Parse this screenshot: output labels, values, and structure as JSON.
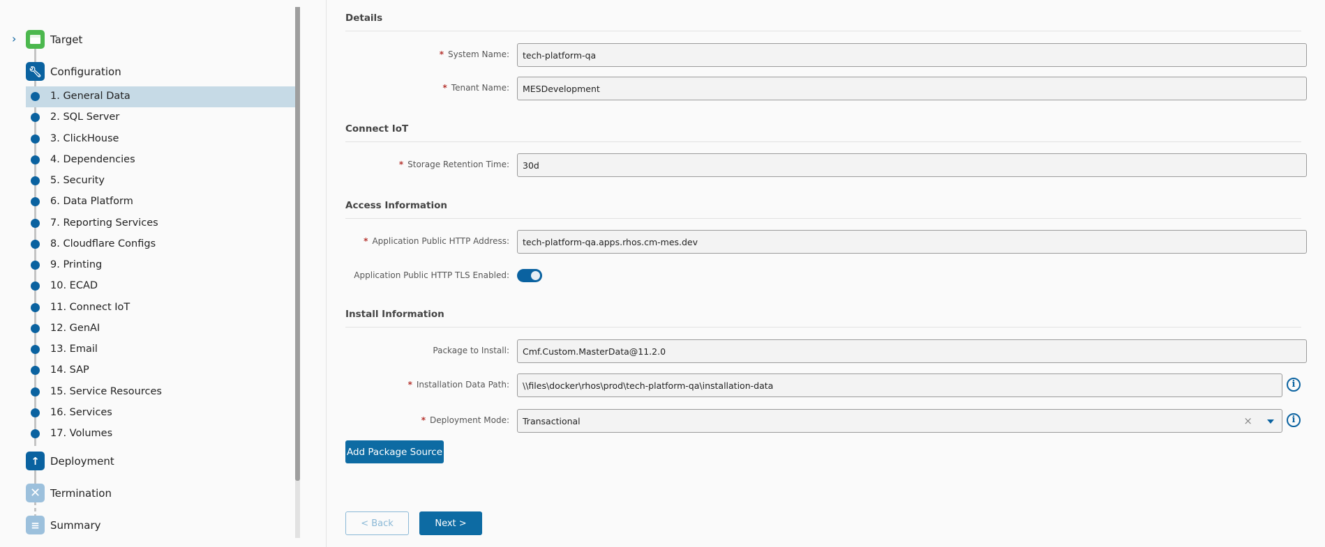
{
  "nav": {
    "phases": {
      "target": "Target",
      "configuration": "Configuration",
      "deployment": "Deployment",
      "termination": "Termination",
      "summary": "Summary"
    },
    "steps": [
      "1. General Data",
      "2. SQL Server",
      "3. ClickHouse",
      "4. Dependencies",
      "5. Security",
      "6. Data Platform",
      "7. Reporting Services",
      "8. Cloudflare Configs",
      "9. Printing",
      "10. ECAD",
      "11. Connect IoT",
      "12. GenAI",
      "13. Email",
      "14. SAP",
      "15. Service Resources",
      "16. Services",
      "17. Volumes"
    ],
    "active_step": 0
  },
  "form": {
    "details": {
      "title": "Details",
      "system_name_label": "System Name:",
      "system_name": "tech-platform-qa",
      "tenant_name_label": "Tenant Name:",
      "tenant_name": "MESDevelopment"
    },
    "connect_iot": {
      "title": "Connect IoT",
      "retention_label": "Storage Retention Time:",
      "retention": "30d"
    },
    "access": {
      "title": "Access Information",
      "address_label": "Application Public HTTP Address:",
      "address": "tech-platform-qa.apps.rhos.cm-mes.dev",
      "tls_label": "Application Public HTTP TLS Enabled:",
      "tls_enabled": true
    },
    "install": {
      "title": "Install Information",
      "package_label": "Package to Install:",
      "package": "Cmf.Custom.MasterData@11.2.0",
      "path_label": "Installation Data Path:",
      "path": "\\\\files\\docker\\rhos\\prod\\tech-platform-qa\\installation-data",
      "mode_label": "Deployment Mode:",
      "mode": "Transactional",
      "add_source": "Add Package Source"
    },
    "required_mark": "*",
    "info_glyph": "i",
    "clear_glyph": "×"
  },
  "footer": {
    "back": "< Back",
    "next": "Next >"
  },
  "colors": {
    "accent": "#0a62a0",
    "target_green": "#4cb84e",
    "required": "#b5332e"
  }
}
